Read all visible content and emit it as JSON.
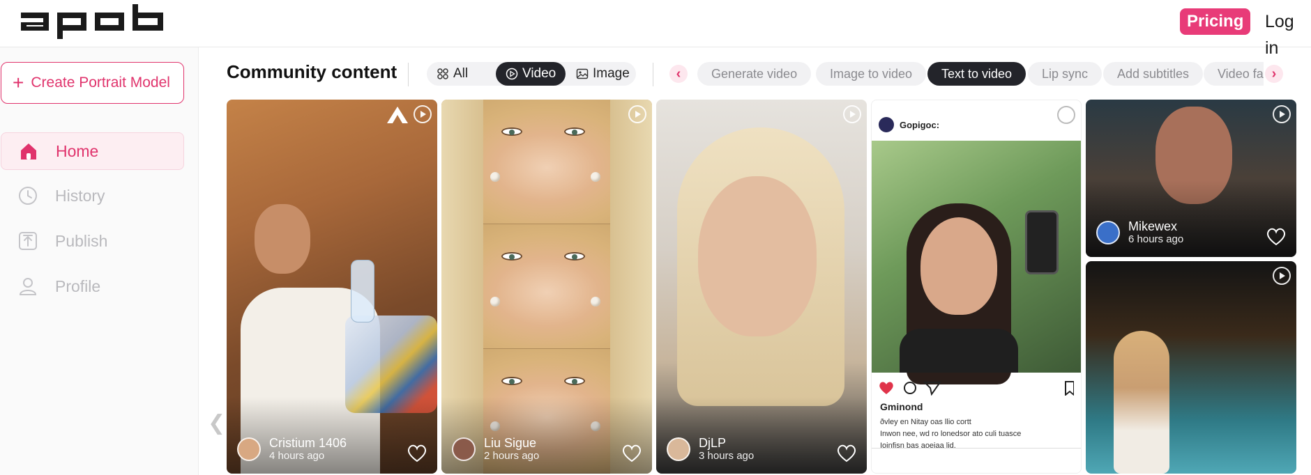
{
  "header": {
    "logo_text": "apob",
    "pricing_label": "Pricing",
    "login_label": "Log in"
  },
  "sidebar": {
    "create_label": "Create Portrait Model",
    "items": [
      {
        "label": "Home",
        "icon": "home-icon",
        "active": true
      },
      {
        "label": "History",
        "icon": "clock-icon",
        "active": false
      },
      {
        "label": "Publish",
        "icon": "upload-icon",
        "active": false
      },
      {
        "label": "Profile",
        "icon": "user-icon",
        "active": false
      }
    ]
  },
  "toolbar": {
    "title": "Community content",
    "filters": [
      {
        "label": "All",
        "icon": "grid-icon",
        "active": false
      },
      {
        "label": "Video",
        "icon": "play-circle-icon",
        "active": true
      },
      {
        "label": "Image",
        "icon": "image-icon",
        "active": false
      }
    ],
    "categories": [
      {
        "label": "Generate video",
        "active": false
      },
      {
        "label": "Image to video",
        "active": false
      },
      {
        "label": "Text to video",
        "active": true
      },
      {
        "label": "Lip sync",
        "active": false
      },
      {
        "label": "Add subtitles",
        "active": false
      },
      {
        "label": "Video face swap",
        "active": false
      }
    ]
  },
  "cards": [
    {
      "author": "Cristium 1406",
      "time": "4 hours ago",
      "type": "video"
    },
    {
      "author": "Liu Sigue",
      "time": "2 hours ago",
      "type": "video"
    },
    {
      "author": "DjLP",
      "time": "3 hours ago",
      "type": "video"
    },
    {
      "author": "Gopigoc:",
      "time": "",
      "type": "video",
      "post_user": "Gminond",
      "caption_lines": [
        "ðvley en Nitay oas llio cortt",
        "Inwon nee, wd ro lonedsor ato culi tuasce",
        "Ioinfisn bas aoeiaa lid."
      ]
    },
    {
      "author": "Mikewex",
      "time": "6 hours ago",
      "type": "video"
    },
    {
      "author": "",
      "time": "",
      "type": "video"
    }
  ],
  "colors": {
    "accent": "#e0336c",
    "pricing_bg": "#e83b78",
    "active_pill": "#23242a"
  }
}
